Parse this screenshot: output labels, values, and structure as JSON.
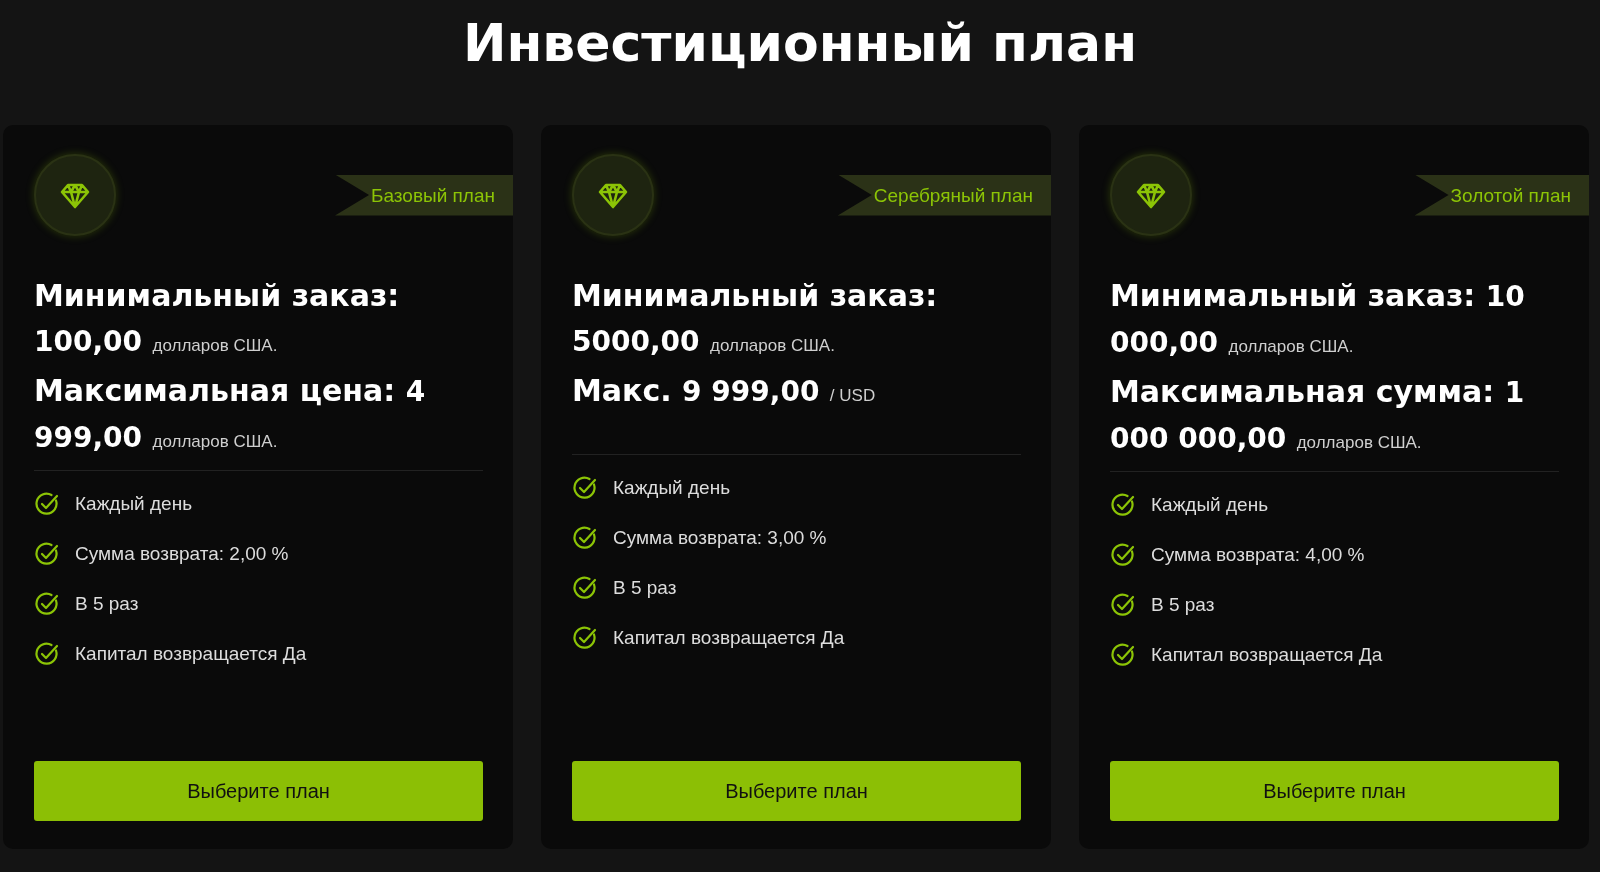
{
  "title": "Инвестиционный план",
  "plans": [
    {
      "badge": "Базовый план",
      "terms": [
        {
          "label": "Минимальный заказ:",
          "amount": "100,00",
          "unit": "долларов США."
        },
        {
          "label": "Максимальная цена:",
          "amount": "4 999,00",
          "unit": "долларов США."
        }
      ],
      "features": [
        "Каждый день",
        "Сумма возврата: 2,00 %",
        "В 5 раз",
        "Капитал возвращается Да"
      ],
      "button": "Выберите план"
    },
    {
      "badge": "Серебряный план",
      "terms": [
        {
          "label": "Минимальный заказ:",
          "amount": "5000,00",
          "unit": "долларов США."
        },
        {
          "label": "Макс.",
          "amount": "9 999,00",
          "unit": "/ USD"
        }
      ],
      "features": [
        "Каждый день",
        "Сумма возврата: 3,00 %",
        "В 5 раз",
        "Капитал возвращается Да"
      ],
      "button": "Выберите план"
    },
    {
      "badge": "Золотой план",
      "terms": [
        {
          "label": "Минимальный заказ:",
          "amount": "10 000,00",
          "unit": "долларов США."
        },
        {
          "label": "Максимальная сумма:",
          "amount": "1 000 000,00",
          "unit": "долларов США."
        }
      ],
      "features": [
        "Каждый день",
        "Сумма возврата: 4,00 %",
        "В 5 раз",
        "Капитал возвращается Да"
      ],
      "button": "Выберите план"
    }
  ]
}
